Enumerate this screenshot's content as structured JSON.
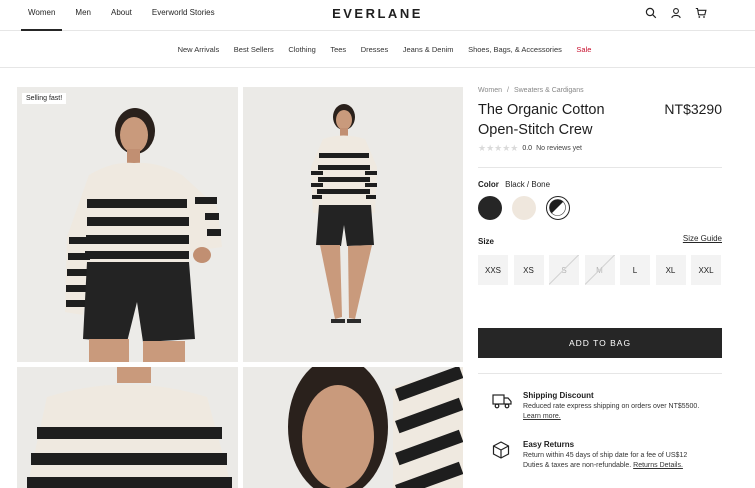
{
  "header": {
    "nav": [
      "Women",
      "Men",
      "About",
      "Everworld Stories"
    ],
    "active_nav": "Women",
    "logo": "EVERLANE",
    "icons": [
      "search-icon",
      "account-icon",
      "cart-icon"
    ]
  },
  "categories": [
    "New Arrivals",
    "Best Sellers",
    "Clothing",
    "Tees",
    "Dresses",
    "Jeans & Denim",
    "Shoes, Bags, & Accessories",
    "Sale"
  ],
  "gallery": {
    "badge": "Selling fast!"
  },
  "product": {
    "breadcrumb": [
      "Women",
      "Sweaters & Cardigans"
    ],
    "breadcrumb_sep": "/",
    "title": "The Organic Cotton Open-Stitch Crew",
    "price": "NT$3290",
    "rating_score": "0.0",
    "reviews": "No reviews yet",
    "color_label": "Color",
    "color_value": "Black / Bone",
    "swatches": [
      {
        "name": "Black",
        "color": "#262626"
      },
      {
        "name": "Bone",
        "color": "#efe7dd"
      },
      {
        "name": "Black / Bone",
        "color": "stripe"
      }
    ],
    "size_label": "Size",
    "size_guide": "Size Guide",
    "sizes": [
      {
        "label": "XXS",
        "available": true
      },
      {
        "label": "XS",
        "available": true
      },
      {
        "label": "S",
        "available": false
      },
      {
        "label": "M",
        "available": false
      },
      {
        "label": "L",
        "available": true
      },
      {
        "label": "XL",
        "available": true
      },
      {
        "label": "XXL",
        "available": true
      }
    ],
    "add_to_bag": "ADD TO BAG"
  },
  "perks": {
    "shipping": {
      "title": "Shipping Discount",
      "desc": "Reduced rate express shipping on orders over NT$5500.",
      "link": "Learn more."
    },
    "returns": {
      "title": "Easy Returns",
      "desc1": "Return within 45 days of ship date for a fee of US$12",
      "desc2": "Duties & taxes are non-refundable.",
      "link": "Returns Details."
    }
  }
}
